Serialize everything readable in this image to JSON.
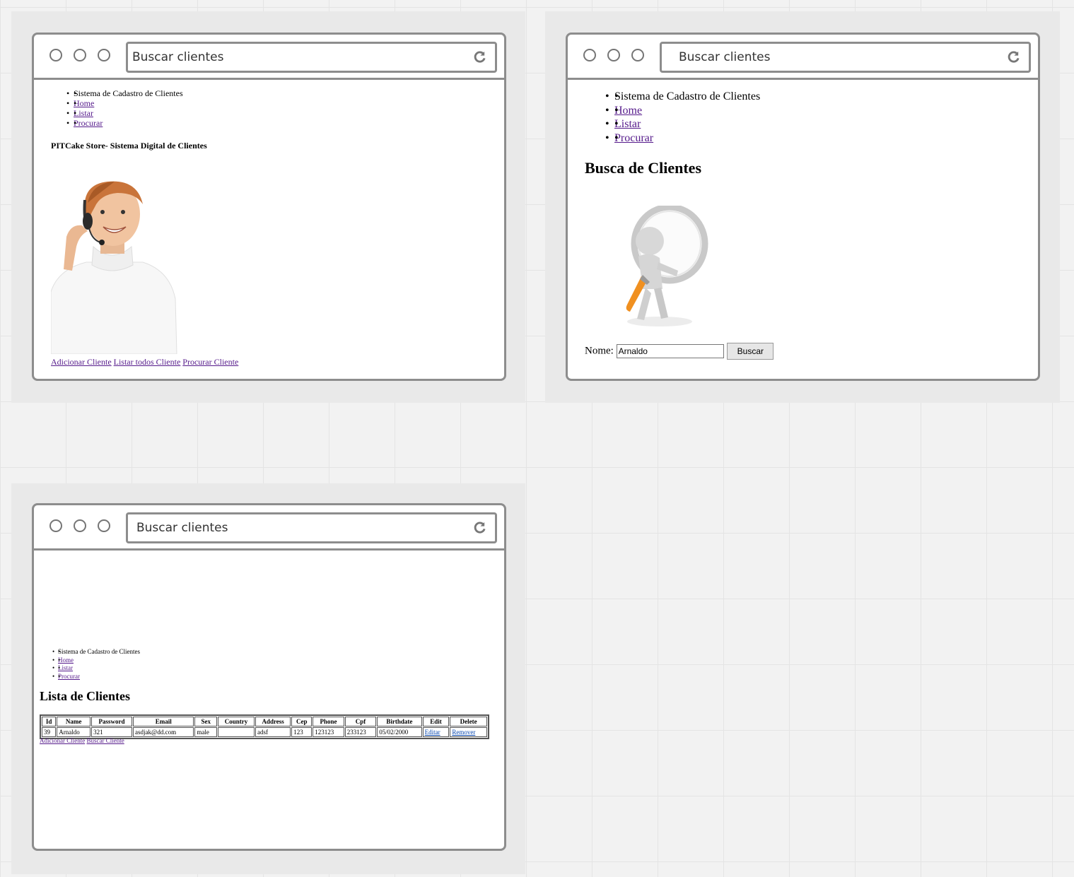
{
  "windows": [
    {
      "address": "Buscar clientes",
      "nav": {
        "items": [
          "Sistema de Cadastro de Clientes"
        ],
        "links": [
          "Home",
          "Listar",
          "Procurar"
        ]
      },
      "heading": "PITCake Store- Sistema Digital de Clientes",
      "bottom_links": [
        "Adicionar Cliente",
        "Listar todos Cliente",
        "Procurar Cliente"
      ]
    },
    {
      "address": "Buscar clientes",
      "nav": {
        "items": [
          "Sistema de Cadastro de Clientes"
        ],
        "links": [
          "Home",
          "Listar",
          "Procurar"
        ]
      },
      "heading": "Busca de Clientes",
      "form": {
        "label": "Nome:",
        "value": "Arnaldo",
        "button": "Buscar"
      }
    },
    {
      "address": "Buscar clientes",
      "nav": {
        "items": [
          "Sistema de Cadastro de Clientes"
        ],
        "links": [
          "Home",
          "Listar",
          "Procurar"
        ]
      },
      "heading": "Lista de Clientes",
      "table": {
        "headers": [
          "Id",
          "Name",
          "Password",
          "Email",
          "Sex",
          "Country",
          "Address",
          "Cep",
          "Phone",
          "Cpf",
          "Birthdate",
          "Edit",
          "Delete"
        ],
        "rows": [
          [
            "39",
            "Arnaldo",
            "321",
            "asdjak@dd.com",
            "male",
            "",
            "adsf",
            "123",
            "123123",
            "233123",
            "05/02/2000",
            "Editar",
            "Remover"
          ]
        ]
      },
      "bottom_links": [
        "Adicionar Cliente",
        "Buscar Cliente"
      ]
    }
  ],
  "colors": {
    "link_visited": "#551a8b",
    "link": "#0645ad",
    "window_border": "#8d8d8d"
  }
}
